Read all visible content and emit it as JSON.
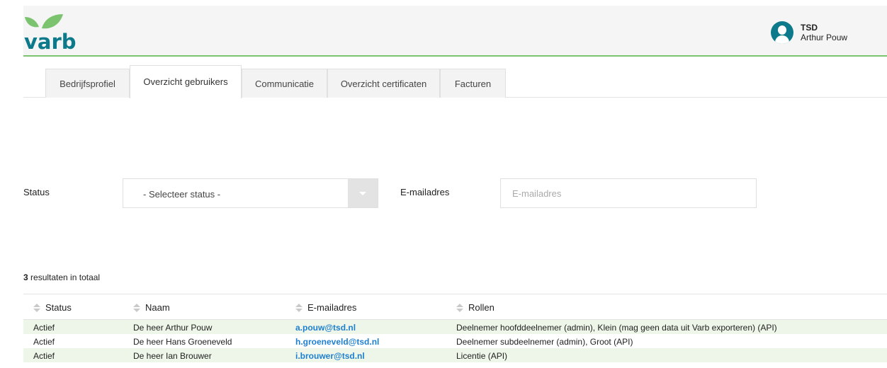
{
  "header": {
    "logo_text": "varb",
    "user": {
      "org": "TSD",
      "name": "Arthur Pouw"
    }
  },
  "tabs": [
    {
      "label": "Bedrijfsprofiel",
      "active": false
    },
    {
      "label": "Overzicht gebruikers",
      "active": true
    },
    {
      "label": "Communicatie",
      "active": false
    },
    {
      "label": "Overzicht certificaten",
      "active": false
    },
    {
      "label": "Facturen",
      "active": false
    }
  ],
  "filters": {
    "status_label": "Status",
    "status_value": "- Selecteer status -",
    "email_label": "E-mailadres",
    "email_placeholder": "E-mailadres",
    "email_value": ""
  },
  "results": {
    "count": "3",
    "suffix": " resultaten in totaal"
  },
  "table": {
    "columns": [
      "Status",
      "Naam",
      "E-mailadres",
      "Rollen"
    ],
    "rows": [
      {
        "status": "Actief",
        "naam": "De heer Arthur Pouw",
        "email": "a.pouw@tsd.nl",
        "rollen": "Deelnemer hoofddeelnemer (admin), Klein (mag geen data uit Varb exporteren) (API)"
      },
      {
        "status": "Actief",
        "naam": "De heer Hans Groeneveld",
        "email": "h.groeneveld@tsd.nl",
        "rollen": "Deelnemer subdeelnemer (admin), Groot (API)"
      },
      {
        "status": "Actief",
        "naam": "De heer Ian Brouwer",
        "email": "i.brouwer@tsd.nl",
        "rollen": "Licentie (API)"
      }
    ]
  },
  "colors": {
    "brand_green": "#7cc36f",
    "brand_teal": "#0c7a8a",
    "link_blue": "#1f7fcf",
    "row_highlight": "#edf6e8"
  }
}
